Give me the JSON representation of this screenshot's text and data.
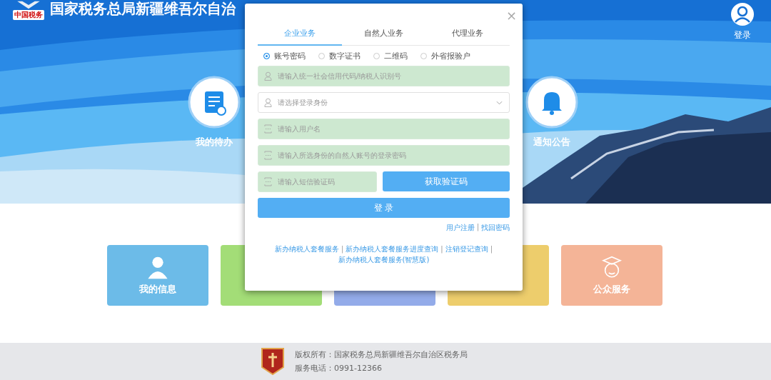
{
  "header": {
    "logo_text": "中国税务",
    "title": "国家税务总局新疆维吾尔自治",
    "login_label": "登录"
  },
  "banner_items": [
    {
      "label": "我的待办",
      "kind": "todo"
    },
    {
      "label": "通知公告",
      "kind": "notice"
    }
  ],
  "cards": [
    {
      "label": "我的信息",
      "color": "#6cbbe8",
      "kind": "person"
    },
    {
      "color": "#a3dd77",
      "kind": "blank"
    },
    {
      "color": "#93abe9",
      "kind": "blank"
    },
    {
      "color": "#edcd6c",
      "kind": "blank"
    },
    {
      "label": "公众服务",
      "color": "#f4b497",
      "kind": "service"
    }
  ],
  "dialog": {
    "close": "×",
    "tabs": [
      {
        "label": "企业业务",
        "selected": true
      },
      {
        "label": "自然人业务",
        "selected": false
      },
      {
        "label": "代理业务",
        "selected": false
      }
    ],
    "radios": [
      {
        "label": "账号密码",
        "selected": true
      },
      {
        "label": "数字证书",
        "selected": false
      },
      {
        "label": "二维码",
        "selected": false
      },
      {
        "label": "外省报验户",
        "selected": false
      }
    ],
    "fields": [
      {
        "placeholder": "请输入统一社会信用代码/纳税人识别号",
        "kind": "user",
        "filled": true
      },
      {
        "placeholder": "请选择登录身份",
        "kind": "select",
        "filled": false
      },
      {
        "placeholder": "请输入用户名",
        "kind": "lock",
        "filled": true
      },
      {
        "placeholder": "请输入所选身份的自然人账号的登录密码",
        "kind": "lock",
        "filled": true
      }
    ],
    "code_field": {
      "placeholder": "请输入短信验证码",
      "filled": true
    },
    "code_button": "获取验证码",
    "login_button": "登 录",
    "separator": "|",
    "account_links": [
      "用户注册",
      "找回密码"
    ],
    "service_links": [
      "新办纳税人套餐服务",
      "新办纳税人套餐服务进度查询",
      "注销登记查询",
      "新办纳税人套餐服务(智慧版)"
    ]
  },
  "footer": {
    "copyright": "版权所有：国家税务总局新疆维吾尔自治区税务局",
    "phone": "服务电话：0991-12366"
  }
}
